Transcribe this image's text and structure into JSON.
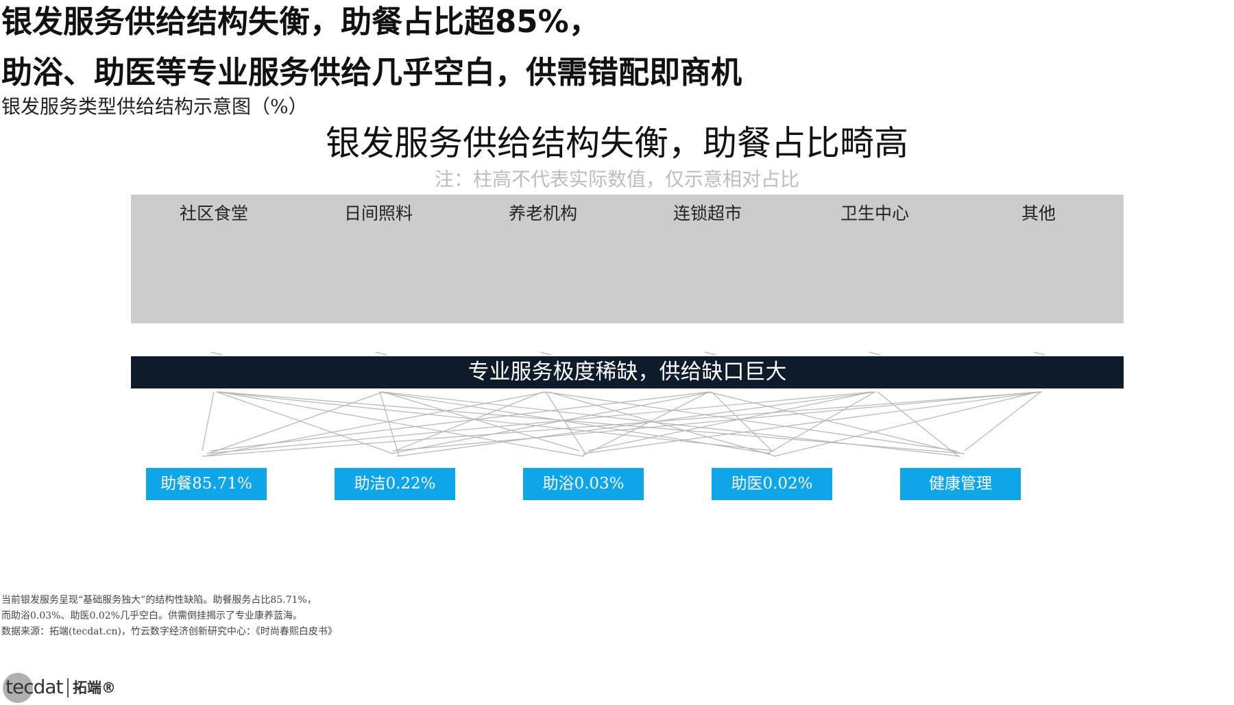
{
  "headline": {
    "line1": "银发服务供给结构失衡，助餐占比超85%，",
    "line2": "助浴、助医等专业服务供给几乎空白，供需错配即商机"
  },
  "subtitle": "银发服务类型供给结构示意图（%）",
  "diagram": {
    "title": "银发服务供给结构失衡，助餐占比畸高",
    "note": "注：柱高不代表实际数值，仅示意相对占比",
    "channels": [
      "社区食堂",
      "日间照料",
      "养老机构",
      "连锁超市",
      "卫生中心",
      "其他"
    ],
    "gap_banner": "专业服务极度稀缺，供给缺口巨大",
    "services": [
      "助餐85.71%",
      "助洁0.22%",
      "助浴0.03%",
      "助医0.02%",
      "健康管理"
    ]
  },
  "chart_data": {
    "type": "table",
    "title": "银发服务供给结构失衡，助餐占比畸高",
    "note": "注：柱高不代表实际数值，仅示意相对占比",
    "sources": [
      "社区食堂",
      "日间照料",
      "养老机构",
      "连锁超市",
      "卫生中心",
      "其他"
    ],
    "targets": [
      {
        "name": "助餐",
        "share_percent": 85.71
      },
      {
        "name": "助洁",
        "share_percent": 0.22
      },
      {
        "name": "助浴",
        "share_percent": 0.03
      },
      {
        "name": "助医",
        "share_percent": 0.02
      },
      {
        "name": "健康管理",
        "share_percent": null
      }
    ],
    "colors": {
      "channel_band": "#cccccc",
      "gap_banner": "#0d1b2a",
      "service_box": "#0ea5e9",
      "flow_line": "#b5b5b5"
    }
  },
  "footnotes": [
    "当前银发服务呈现“基础服务独大”的结构性缺陷。助餐服务占比85.71%，",
    "而助浴0.03%、助医0.02%几乎空白。供需倒挂揭示了专业康养蓝海。",
    "数据来源：拓端(tecdat.cn)，竹云数字经济创新研究中心：《时尚春熙白皮书》"
  ],
  "logo": {
    "brand": "tecdat",
    "cn": "拓端®"
  }
}
